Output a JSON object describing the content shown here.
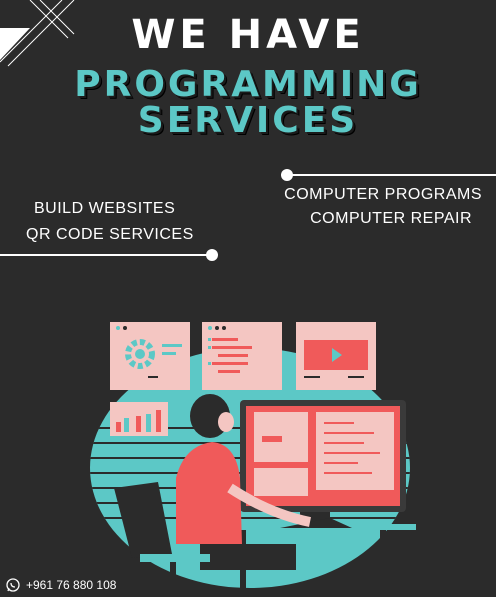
{
  "headline": {
    "line1": "WE HAVE",
    "line2": "PROGRAMMING",
    "line3": "SERVICES"
  },
  "services_right": [
    "COMPUTER PROGRAMS",
    "COMPUTER REPAIR"
  ],
  "services_left": [
    "BUILD WEBSITES",
    "QR CODE SERVICES"
  ],
  "footer": {
    "icon": "whatsapp-icon",
    "phone": "+961 76 880 108"
  },
  "colors": {
    "background": "#2b2b2b",
    "accent_teal": "#5cc8c6",
    "accent_pink": "#f4c6c2",
    "accent_red": "#f05a5a"
  }
}
